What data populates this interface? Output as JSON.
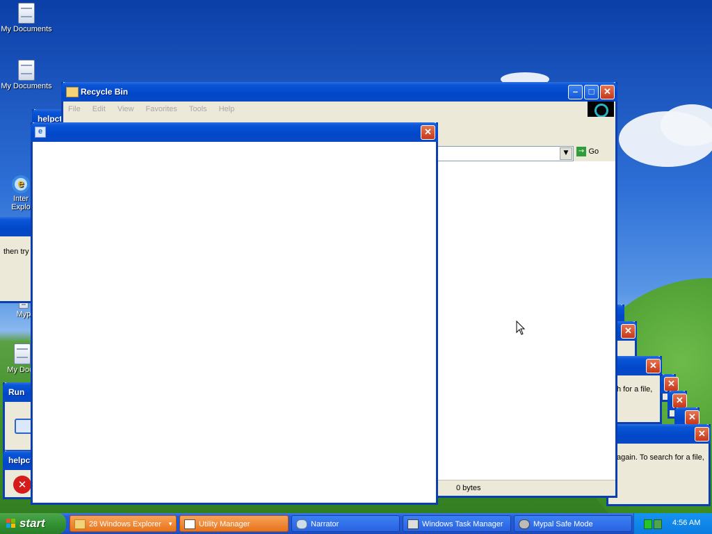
{
  "desktop": {
    "icons": [
      {
        "label": "My Documents"
      },
      {
        "label": "My Documents"
      },
      {
        "label": "Inter Explo"
      },
      {
        "label": "Myp"
      },
      {
        "label": "My Docu"
      }
    ]
  },
  "recycle_bin": {
    "title": "Recycle Bin",
    "menu": [
      "File",
      "Edit",
      "View",
      "Favorites",
      "Tools",
      "Help"
    ],
    "go_label": "Go",
    "status_size": "0 bytes"
  },
  "bg_windows": {
    "helpctr_title": "helpct",
    "helpctr_title_2": "helpct",
    "run_title": "Run",
    "left_text": "then try a",
    "right_text_1": "h for a file,",
    "right_text_2": "again. To search for a file,"
  },
  "ie_window": {
    "title": ""
  },
  "taskbar": {
    "start_label": "start",
    "items": [
      {
        "label": "28 Windows Explorer",
        "icon": "folder-icon"
      },
      {
        "label": "Utility Manager",
        "icon": "utility-icon"
      },
      {
        "label": "Narrator",
        "icon": "narrator-icon"
      },
      {
        "label": "Windows Task Manager",
        "icon": "taskmgr-icon"
      },
      {
        "label": "Mypal Safe Mode",
        "icon": "mypal-icon"
      }
    ],
    "clock": "4:56 AM"
  },
  "colors": {
    "title_active": "#0047c9",
    "taskbar": "#245edb",
    "start_green": "#2f8f2f",
    "highlight_orange": "#e8731a"
  }
}
